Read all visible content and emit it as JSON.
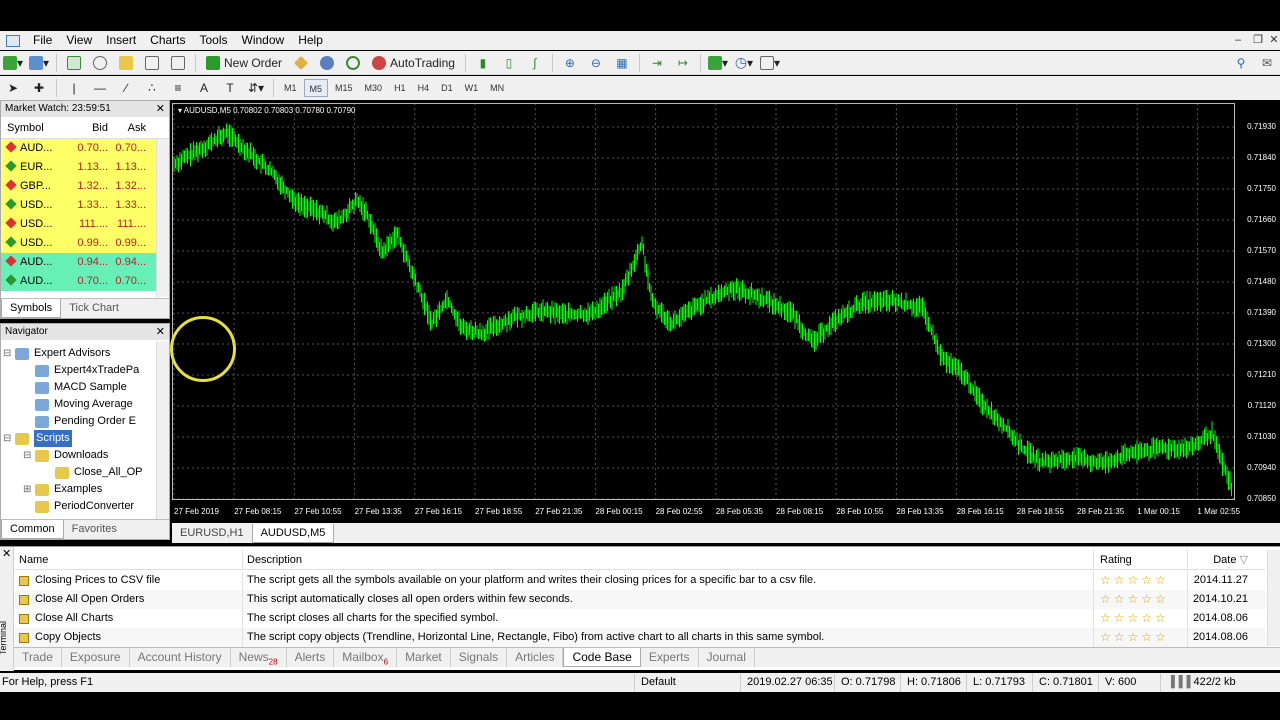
{
  "menu": [
    "File",
    "View",
    "Insert",
    "Charts",
    "Tools",
    "Window",
    "Help"
  ],
  "toolbar": {
    "new_order": "New Order",
    "autotrading": "AutoTrading"
  },
  "timeframes": [
    "M1",
    "M5",
    "M15",
    "M30",
    "H1",
    "H4",
    "D1",
    "W1",
    "MN"
  ],
  "active_timeframe": "M5",
  "market_watch": {
    "title": "Market Watch: 23:59:51",
    "headers": {
      "symbol": "Symbol",
      "bid": "Bid",
      "ask": "Ask"
    },
    "rows": [
      {
        "symbol": "AUD...",
        "bid": "0.70...",
        "ask": "0.70...",
        "dir": "down",
        "bg": "#ffff66"
      },
      {
        "symbol": "EUR...",
        "bid": "1.13...",
        "ask": "1.13...",
        "dir": "up",
        "bg": "#ffff66"
      },
      {
        "symbol": "GBP...",
        "bid": "1.32...",
        "ask": "1.32...",
        "dir": "down",
        "bg": "#ffff66"
      },
      {
        "symbol": "USD...",
        "bid": "1.33...",
        "ask": "1.33...",
        "dir": "up",
        "bg": "#ffff66"
      },
      {
        "symbol": "USD...",
        "bid": "111....",
        "ask": "111....",
        "dir": "down",
        "bg": "#ffff66"
      },
      {
        "symbol": "USD...",
        "bid": "0.99...",
        "ask": "0.99...",
        "dir": "up",
        "bg": "#ffff66"
      },
      {
        "symbol": "AUD...",
        "bid": "0.94...",
        "ask": "0.94...",
        "dir": "down",
        "bg": "#66f0b8"
      },
      {
        "symbol": "AUD...",
        "bid": "0.70...",
        "ask": "0.70...",
        "dir": "up",
        "bg": "#66f0b8"
      }
    ],
    "tabs": [
      "Symbols",
      "Tick Chart"
    ]
  },
  "navigator": {
    "title": "Navigator",
    "items": [
      {
        "label": "Expert Advisors",
        "level": 0
      },
      {
        "label": "Expert4xTradePa",
        "level": 1
      },
      {
        "label": "MACD Sample",
        "level": 1
      },
      {
        "label": "Moving Average",
        "level": 1
      },
      {
        "label": "Pending Order E",
        "level": 1
      },
      {
        "label": "Scripts",
        "level": 0
      },
      {
        "label": "Downloads",
        "level": 1
      },
      {
        "label": "Close_All_OP",
        "level": 2
      },
      {
        "label": "Examples",
        "level": 1
      },
      {
        "label": "PeriodConverter",
        "level": 1
      }
    ],
    "tabs": [
      "Common",
      "Favorites"
    ]
  },
  "chart": {
    "title": "AUDUSD,M5  0.70802 0.70803 0.70780 0.70790",
    "price_labels": [
      "0.71930",
      "0.71840",
      "0.71750",
      "0.71660",
      "0.71570",
      "0.71480",
      "0.71390",
      "0.71300",
      "0.71210",
      "0.71120",
      "0.71030",
      "0.70940",
      "0.70850"
    ],
    "time_labels": [
      "27 Feb 2019",
      "27 Feb 08:15",
      "27 Feb 10:55",
      "27 Feb 13:35",
      "27 Feb 16:15",
      "27 Feb 18:55",
      "27 Feb 21:35",
      "28 Feb 00:15",
      "28 Feb 02:55",
      "28 Feb 05:35",
      "28 Feb 08:15",
      "28 Feb 10:55",
      "28 Feb 13:35",
      "28 Feb 16:15",
      "28 Feb 18:55",
      "28 Feb 21:35",
      "1 Mar 00:15",
      "1 Mar 02:55"
    ],
    "tabs": [
      "EURUSD,H1",
      "AUDUSD,M5"
    ],
    "line_color": "#00ff00"
  },
  "codebase": {
    "headers": {
      "name": "Name",
      "desc": "Description",
      "rating": "Rating",
      "date": "Date"
    },
    "rows": [
      {
        "name": "Closing Prices to CSV file",
        "desc": "The script gets all the symbols available on your platform and writes their closing prices for a specific bar to a csv file.",
        "rating": "☆☆☆☆☆",
        "date": "2014.11.27"
      },
      {
        "name": "Close All Open Orders",
        "desc": "This script automatically closes all open orders within few seconds.",
        "rating": "☆☆☆☆☆",
        "date": "2014.10.21"
      },
      {
        "name": "Close All Charts",
        "desc": "The script closes all charts for the specified symbol.",
        "rating": "☆☆☆☆☆",
        "date": "2014.08.06"
      },
      {
        "name": "Copy Objects",
        "desc": "The script copy objects (Trendline, Horizontal Line, Rectangle, Fibo) from active chart to all charts in this same symbol.",
        "rating": "☆☆☆☆☆",
        "date": "2014.08.06"
      }
    ]
  },
  "terminal_tabs": [
    {
      "label": "Trade",
      "badge": ""
    },
    {
      "label": "Exposure",
      "badge": ""
    },
    {
      "label": "Account History",
      "badge": ""
    },
    {
      "label": "News",
      "badge": "28"
    },
    {
      "label": "Alerts",
      "badge": ""
    },
    {
      "label": "Mailbox",
      "badge": "6"
    },
    {
      "label": "Market",
      "badge": ""
    },
    {
      "label": "Signals",
      "badge": ""
    },
    {
      "label": "Articles",
      "badge": ""
    },
    {
      "label": "Code Base",
      "badge": ""
    },
    {
      "label": "Experts",
      "badge": ""
    },
    {
      "label": "Journal",
      "badge": ""
    }
  ],
  "terminal_side_label": "Terminal",
  "status": {
    "help": "For Help, press F1",
    "profile": "Default",
    "datetime": "2019.02.27 06:35",
    "open": "O: 0.71798",
    "high": "H: 0.71806",
    "low": "L: 0.71793",
    "close": "C: 0.71801",
    "volume": "V: 600",
    "traffic": "422/2 kb"
  }
}
